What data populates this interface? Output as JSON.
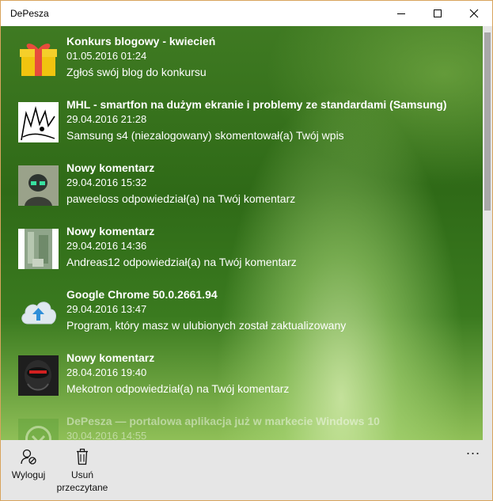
{
  "window": {
    "title": "DePesza"
  },
  "notifications": [
    {
      "title": "Konkurs blogowy - kwiecień",
      "date": "01.05.2016 01:24",
      "description": "Zgłoś swój blog do konkursu",
      "icon": "gift-icon"
    },
    {
      "title": "MHL - smartfon na dużym ekranie i problemy ze standardami (Samsung)",
      "date": "29.04.2016 21:28",
      "description": "Samsung s4 (niezalogowany) skomentował(a) Twój wpis",
      "icon": "avatar-sketch"
    },
    {
      "title": "Nowy komentarz",
      "date": "29.04.2016 15:32",
      "description": "paweeloss odpowiedział(a) na Twój komentarz",
      "icon": "avatar-helmet"
    },
    {
      "title": "Nowy komentarz",
      "date": "29.04.2016 14:36",
      "description": "Andreas12 odpowiedział(a) na Twój komentarz",
      "icon": "avatar-photo"
    },
    {
      "title": "Google Chrome 50.0.2661.94",
      "date": "29.04.2016 13:47",
      "description": "Program, który masz w ulubionych został zaktualizowany",
      "icon": "cloud-upload-icon"
    },
    {
      "title": "Nowy komentarz",
      "date": "28.04.2016 19:40",
      "description": "Mekotron odpowiedział(a) na Twój komentarz",
      "icon": "avatar-robot"
    },
    {
      "title": "DePesza — portalowa aplikacja już w markecie Windows 10",
      "date": "30.04.2016 14:55",
      "description": "",
      "icon": "app-logo"
    }
  ],
  "appbar": {
    "logout_label": "Wyloguj",
    "delete_read_label_line1": "Usuń",
    "delete_read_label_line2": "przeczytane",
    "more_label": "..."
  },
  "colors": {
    "accent_green": "#3a7a1f",
    "appbar_bg": "#e6e6e6",
    "frame": "#d8a45c"
  }
}
